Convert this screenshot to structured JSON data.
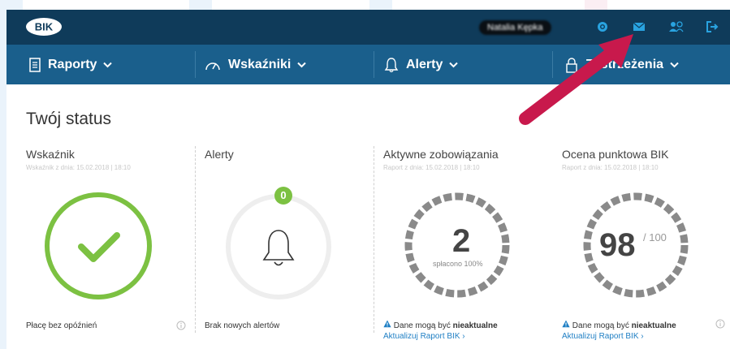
{
  "header": {
    "logo_text": "BIK",
    "user_name": "Natalia Kępka",
    "icons": [
      "gear-icon",
      "envelope-icon",
      "users-icon",
      "logout-icon"
    ]
  },
  "nav": {
    "items": [
      {
        "label": "Raporty",
        "icon": "document-icon"
      },
      {
        "label": "Wskaźniki",
        "icon": "gauge-icon"
      },
      {
        "label": "Alerty",
        "icon": "bell-icon"
      },
      {
        "label": "Zastrzeżenia",
        "icon": "lock-icon"
      }
    ]
  },
  "status": {
    "title": "Twój status",
    "cards": [
      {
        "title": "Wskaźnik",
        "subtitle": "Wskaźnik z dnia: 15.02.2018 | 18:10",
        "footer": "Płacę bez opóźnień"
      },
      {
        "title": "Alerty",
        "badge": "0",
        "footer": "Brak nowych alertów"
      },
      {
        "title": "Aktywne zobowiązania",
        "subtitle": "Raport z dnia: 15.02.2018 | 18:10",
        "value": "2",
        "value_caption": "spłacono 100%",
        "warning_prefix": "Dane mogą być ",
        "warning_bold": "nieaktualne",
        "link": "Aktualizuj Raport BIK ›"
      },
      {
        "title": "Ocena punktowa BIK",
        "subtitle": "Raport z dnia: 15.02.2018 | 18:10",
        "value": "98",
        "value_suffix": "/ 100",
        "warning_prefix": "Dane mogą być ",
        "warning_bold": "nieaktualne",
        "link": "Aktualizuj Raport BIK ›"
      }
    ]
  },
  "colors": {
    "topbar": "#0f3b5a",
    "navbar": "#1a5f8c",
    "accent_green": "#7cc142",
    "link_blue": "#1f7fc4",
    "arrow": "#c8194c"
  }
}
